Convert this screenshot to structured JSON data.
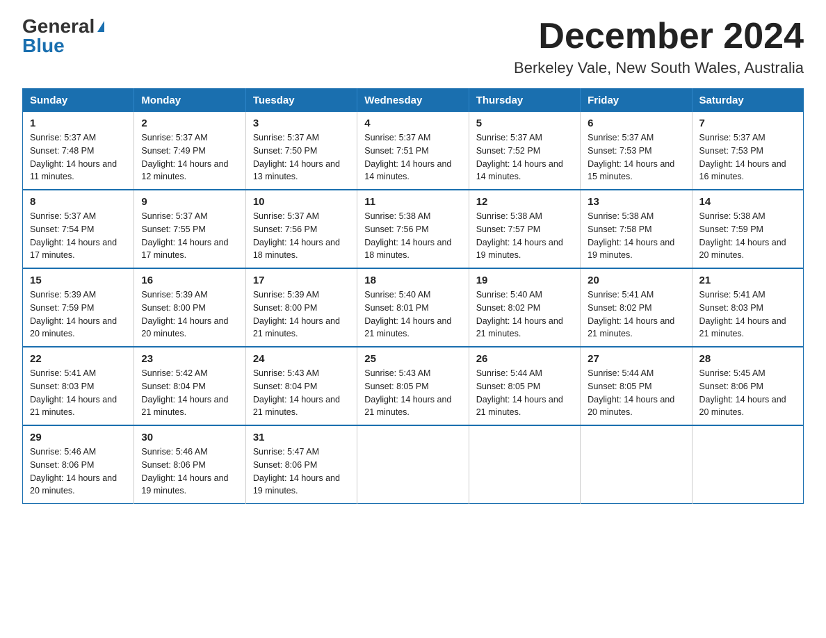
{
  "header": {
    "logo_general": "General",
    "logo_blue": "Blue",
    "month_title": "December 2024",
    "location": "Berkeley Vale, New South Wales, Australia"
  },
  "days_of_week": [
    "Sunday",
    "Monday",
    "Tuesday",
    "Wednesday",
    "Thursday",
    "Friday",
    "Saturday"
  ],
  "weeks": [
    [
      {
        "num": "1",
        "sunrise": "5:37 AM",
        "sunset": "7:48 PM",
        "daylight": "14 hours and 11 minutes."
      },
      {
        "num": "2",
        "sunrise": "5:37 AM",
        "sunset": "7:49 PM",
        "daylight": "14 hours and 12 minutes."
      },
      {
        "num": "3",
        "sunrise": "5:37 AM",
        "sunset": "7:50 PM",
        "daylight": "14 hours and 13 minutes."
      },
      {
        "num": "4",
        "sunrise": "5:37 AM",
        "sunset": "7:51 PM",
        "daylight": "14 hours and 14 minutes."
      },
      {
        "num": "5",
        "sunrise": "5:37 AM",
        "sunset": "7:52 PM",
        "daylight": "14 hours and 14 minutes."
      },
      {
        "num": "6",
        "sunrise": "5:37 AM",
        "sunset": "7:53 PM",
        "daylight": "14 hours and 15 minutes."
      },
      {
        "num": "7",
        "sunrise": "5:37 AM",
        "sunset": "7:53 PM",
        "daylight": "14 hours and 16 minutes."
      }
    ],
    [
      {
        "num": "8",
        "sunrise": "5:37 AM",
        "sunset": "7:54 PM",
        "daylight": "14 hours and 17 minutes."
      },
      {
        "num": "9",
        "sunrise": "5:37 AM",
        "sunset": "7:55 PM",
        "daylight": "14 hours and 17 minutes."
      },
      {
        "num": "10",
        "sunrise": "5:37 AM",
        "sunset": "7:56 PM",
        "daylight": "14 hours and 18 minutes."
      },
      {
        "num": "11",
        "sunrise": "5:38 AM",
        "sunset": "7:56 PM",
        "daylight": "14 hours and 18 minutes."
      },
      {
        "num": "12",
        "sunrise": "5:38 AM",
        "sunset": "7:57 PM",
        "daylight": "14 hours and 19 minutes."
      },
      {
        "num": "13",
        "sunrise": "5:38 AM",
        "sunset": "7:58 PM",
        "daylight": "14 hours and 19 minutes."
      },
      {
        "num": "14",
        "sunrise": "5:38 AM",
        "sunset": "7:59 PM",
        "daylight": "14 hours and 20 minutes."
      }
    ],
    [
      {
        "num": "15",
        "sunrise": "5:39 AM",
        "sunset": "7:59 PM",
        "daylight": "14 hours and 20 minutes."
      },
      {
        "num": "16",
        "sunrise": "5:39 AM",
        "sunset": "8:00 PM",
        "daylight": "14 hours and 20 minutes."
      },
      {
        "num": "17",
        "sunrise": "5:39 AM",
        "sunset": "8:00 PM",
        "daylight": "14 hours and 21 minutes."
      },
      {
        "num": "18",
        "sunrise": "5:40 AM",
        "sunset": "8:01 PM",
        "daylight": "14 hours and 21 minutes."
      },
      {
        "num": "19",
        "sunrise": "5:40 AM",
        "sunset": "8:02 PM",
        "daylight": "14 hours and 21 minutes."
      },
      {
        "num": "20",
        "sunrise": "5:41 AM",
        "sunset": "8:02 PM",
        "daylight": "14 hours and 21 minutes."
      },
      {
        "num": "21",
        "sunrise": "5:41 AM",
        "sunset": "8:03 PM",
        "daylight": "14 hours and 21 minutes."
      }
    ],
    [
      {
        "num": "22",
        "sunrise": "5:41 AM",
        "sunset": "8:03 PM",
        "daylight": "14 hours and 21 minutes."
      },
      {
        "num": "23",
        "sunrise": "5:42 AM",
        "sunset": "8:04 PM",
        "daylight": "14 hours and 21 minutes."
      },
      {
        "num": "24",
        "sunrise": "5:43 AM",
        "sunset": "8:04 PM",
        "daylight": "14 hours and 21 minutes."
      },
      {
        "num": "25",
        "sunrise": "5:43 AM",
        "sunset": "8:05 PM",
        "daylight": "14 hours and 21 minutes."
      },
      {
        "num": "26",
        "sunrise": "5:44 AM",
        "sunset": "8:05 PM",
        "daylight": "14 hours and 21 minutes."
      },
      {
        "num": "27",
        "sunrise": "5:44 AM",
        "sunset": "8:05 PM",
        "daylight": "14 hours and 20 minutes."
      },
      {
        "num": "28",
        "sunrise": "5:45 AM",
        "sunset": "8:06 PM",
        "daylight": "14 hours and 20 minutes."
      }
    ],
    [
      {
        "num": "29",
        "sunrise": "5:46 AM",
        "sunset": "8:06 PM",
        "daylight": "14 hours and 20 minutes."
      },
      {
        "num": "30",
        "sunrise": "5:46 AM",
        "sunset": "8:06 PM",
        "daylight": "14 hours and 19 minutes."
      },
      {
        "num": "31",
        "sunrise": "5:47 AM",
        "sunset": "8:06 PM",
        "daylight": "14 hours and 19 minutes."
      },
      {
        "num": "",
        "sunrise": "",
        "sunset": "",
        "daylight": ""
      },
      {
        "num": "",
        "sunrise": "",
        "sunset": "",
        "daylight": ""
      },
      {
        "num": "",
        "sunrise": "",
        "sunset": "",
        "daylight": ""
      },
      {
        "num": "",
        "sunrise": "",
        "sunset": "",
        "daylight": ""
      }
    ]
  ]
}
